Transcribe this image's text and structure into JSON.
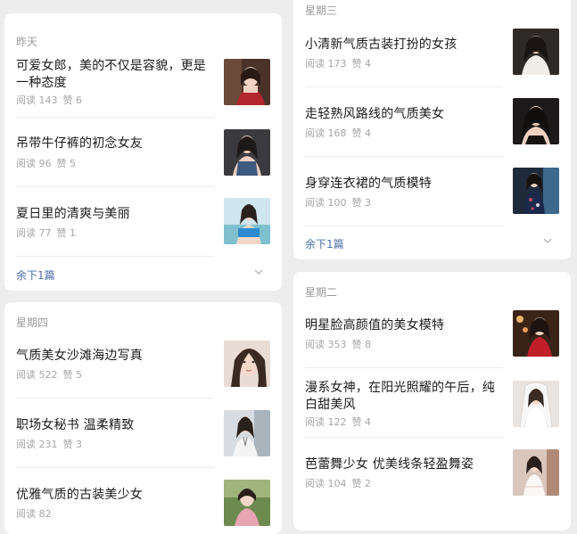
{
  "left_column": {
    "cards": [
      {
        "day": "昨天",
        "items": [
          {
            "title": "可爱女郎，美的不仅是容貌，更是一种态度",
            "views": "阅读 143",
            "likes": "赞 6",
            "thumb": "portrait-red-dress"
          },
          {
            "title": "吊带牛仔裤的初念女友",
            "views": "阅读 96",
            "likes": "赞 5",
            "thumb": "portrait-denim"
          },
          {
            "title": "夏日里的清爽与美丽",
            "views": "阅读 77",
            "likes": "赞 1",
            "thumb": "portrait-beach-blue"
          }
        ],
        "more_label": "余下1篇"
      },
      {
        "day": "星期四",
        "items": [
          {
            "title": "气质美女沙滩海边写真",
            "views": "阅读 522",
            "likes": "赞 5",
            "thumb": "portrait-closeup"
          },
          {
            "title": "职场女秘书 温柔精致",
            "views": "阅读 231",
            "likes": "赞 3",
            "thumb": "portrait-office"
          },
          {
            "title": "优雅气质的古装美少女",
            "views": "阅读 82",
            "likes": "",
            "thumb": "portrait-hanfu"
          }
        ]
      }
    ]
  },
  "right_column": {
    "cards": [
      {
        "day": "星期三",
        "items": [
          {
            "title": "小清新气质古装打扮的女孩",
            "views": "阅读 173",
            "likes": "赞 4",
            "thumb": "portrait-white-top"
          },
          {
            "title": "走轻熟风路线的气质美女",
            "views": "阅读 168",
            "likes": "赞 4",
            "thumb": "portrait-dark"
          },
          {
            "title": "身穿连衣裙的气质模特",
            "views": "阅读 100",
            "likes": "赞 3",
            "thumb": "portrait-floral-dress"
          }
        ],
        "more_label": "余下1篇"
      },
      {
        "day": "星期二",
        "items": [
          {
            "title": "明星脸高颜值的美女模特",
            "views": "阅读 353",
            "likes": "赞 8",
            "thumb": "portrait-red-top"
          },
          {
            "title": " 漫系女神，在阳光照耀的午后，纯白甜美风",
            "views": "阅读 122",
            "likes": "赞 4",
            "thumb": "portrait-bridal"
          },
          {
            "title": "芭蕾舞少女 优美线条轻盈舞姿",
            "views": "阅读 104",
            "likes": "赞 2",
            "thumb": "portrait-ballet"
          }
        ]
      }
    ]
  },
  "colors": {
    "link": "#4a6fa8",
    "meta": "#a6a6a6",
    "day_label": "#9a9a9a",
    "background": "#ededed"
  }
}
